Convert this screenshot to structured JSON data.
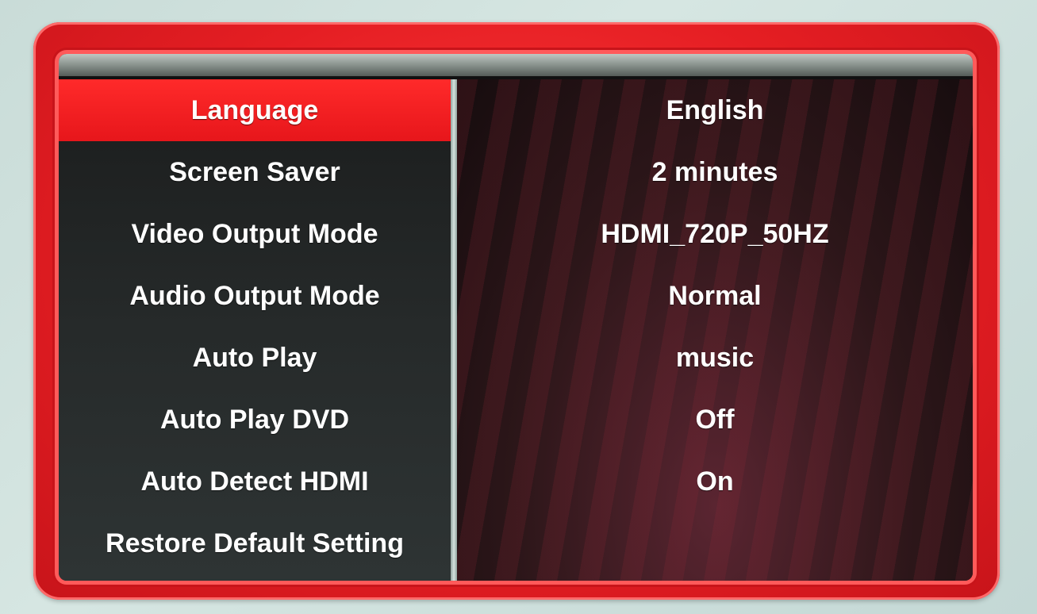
{
  "menu": {
    "items": [
      {
        "label": "Language",
        "selected": true
      },
      {
        "label": "Screen Saver"
      },
      {
        "label": "Video Output Mode"
      },
      {
        "label": "Audio Output Mode"
      },
      {
        "label": "Auto Play"
      },
      {
        "label": "Auto Play DVD"
      },
      {
        "label": "Auto Detect HDMI"
      },
      {
        "label": "Restore Default Setting"
      }
    ]
  },
  "values": {
    "items": [
      {
        "value": "English"
      },
      {
        "value": "2 minutes"
      },
      {
        "value": "HDMI_720P_50HZ"
      },
      {
        "value": "Normal"
      },
      {
        "value": "music"
      },
      {
        "value": "Off"
      },
      {
        "value": "On"
      }
    ]
  },
  "colors": {
    "frame_red": "#e51e23",
    "selection_red": "#ff2a2a",
    "text": "#ffffff",
    "menu_background": "#1b1d1d"
  }
}
